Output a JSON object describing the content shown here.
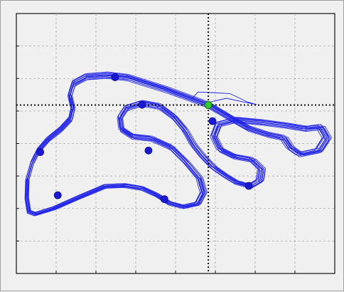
{
  "chart_data": {
    "type": "scatter",
    "title": "",
    "xlabel": "",
    "ylabel": "",
    "grid": true,
    "xlim": [
      0,
      100
    ],
    "ylim": [
      0,
      100
    ],
    "x_ticks": [
      0,
      12.5,
      25,
      37.5,
      50,
      62.5,
      75,
      87.5,
      100
    ],
    "y_ticks": [
      0,
      12.5,
      25,
      37.5,
      50,
      62.5,
      75,
      87.5,
      100
    ],
    "crosshair": {
      "x": 60.3,
      "y": 64.8
    },
    "colors": {
      "trace": "#1f22e6",
      "marker": "#1a1ad6",
      "current": "#2ecc2e",
      "grid": "#a8a8a8",
      "crosshair": "#111111",
      "background": "#f0f0f0"
    },
    "markers": [
      {
        "x": 31.0,
        "y": 75.5
      },
      {
        "x": 39.5,
        "y": 64.9
      },
      {
        "x": 41.5,
        "y": 47.3
      },
      {
        "x": 46.5,
        "y": 28.6
      },
      {
        "x": 61.6,
        "y": 58.6
      },
      {
        "x": 73.0,
        "y": 33.7
      },
      {
        "x": 7.5,
        "y": 46.7
      },
      {
        "x": 13.0,
        "y": 30.1
      }
    ],
    "current_point": {
      "x": 60.3,
      "y": 64.8
    },
    "track": [
      [
        60.3,
        64.8
      ],
      [
        47.5,
        70.5
      ],
      [
        35.0,
        75.3
      ],
      [
        28.5,
        76.2
      ],
      [
        22.0,
        75.6
      ],
      [
        18.0,
        73.0
      ],
      [
        16.8,
        68.2
      ],
      [
        17.8,
        63.5
      ],
      [
        17.0,
        59.3
      ],
      [
        14.0,
        55.4
      ],
      [
        10.0,
        51.5
      ],
      [
        7.0,
        47.3
      ],
      [
        5.0,
        42.5
      ],
      [
        3.5,
        36.1
      ],
      [
        3.3,
        29.1
      ],
      [
        4.0,
        23.7
      ],
      [
        6.0,
        22.8
      ],
      [
        12.0,
        25.1
      ],
      [
        20.0,
        29.4
      ],
      [
        28.0,
        33.5
      ],
      [
        34.0,
        33.8
      ],
      [
        39.5,
        32.7
      ],
      [
        44.0,
        30.2
      ],
      [
        48.0,
        27.0
      ],
      [
        52.5,
        25.6
      ],
      [
        57.0,
        26.8
      ],
      [
        58.8,
        31.0
      ],
      [
        57.5,
        36.6
      ],
      [
        53.5,
        42.5
      ],
      [
        48.5,
        48.5
      ],
      [
        42.5,
        51.8
      ],
      [
        36.5,
        52.6
      ],
      [
        33.0,
        55.4
      ],
      [
        32.5,
        59.8
      ],
      [
        34.5,
        63.5
      ],
      [
        39.5,
        65.4
      ],
      [
        45.0,
        64.2
      ],
      [
        49.5,
        60.1
      ],
      [
        53.0,
        55.0
      ],
      [
        55.5,
        49.6
      ],
      [
        58.5,
        45.0
      ],
      [
        62.0,
        40.6
      ],
      [
        65.5,
        37.6
      ],
      [
        69.0,
        35.0
      ],
      [
        73.5,
        33.5
      ],
      [
        76.5,
        35.7
      ],
      [
        77.0,
        40.1
      ],
      [
        74.0,
        43.7
      ],
      [
        68.5,
        44.9
      ],
      [
        64.0,
        47.6
      ],
      [
        62.0,
        52.5
      ],
      [
        63.5,
        57.3
      ],
      [
        69.0,
        59.0
      ],
      [
        77.0,
        58.1
      ],
      [
        85.0,
        56.8
      ],
      [
        91.0,
        55.6
      ],
      [
        95.5,
        56.3
      ],
      [
        97.5,
        52.0
      ],
      [
        95.0,
        47.2
      ],
      [
        89.0,
        45.7
      ],
      [
        86.0,
        48.3
      ],
      [
        84.0,
        52.1
      ],
      [
        79.5,
        53.2
      ],
      [
        73.0,
        55.7
      ],
      [
        66.5,
        60.3
      ],
      [
        60.3,
        64.8
      ]
    ],
    "loops": [
      {
        "dx": 0.0,
        "dy": 0.0,
        "sx": 1.0,
        "sy": 1.0
      },
      {
        "dx": 0.4,
        "dy": 0.5,
        "sx": 1.005,
        "sy": 1.008
      },
      {
        "dx": -0.4,
        "dy": -0.4,
        "sx": 0.996,
        "sy": 0.994
      },
      {
        "dx": 0.8,
        "dy": -0.2,
        "sx": 1.008,
        "sy": 0.998
      },
      {
        "dx": -0.7,
        "dy": 0.7,
        "sx": 0.993,
        "sy": 1.004
      },
      {
        "dx": 0.2,
        "dy": 1.0,
        "sx": 1.0,
        "sy": 1.012
      },
      {
        "dx": -0.2,
        "dy": -0.9,
        "sx": 1.002,
        "sy": 0.99
      },
      {
        "dx": 1.0,
        "dy": 0.3,
        "sx": 1.01,
        "sy": 1.0
      },
      {
        "dx": -1.0,
        "dy": 0.1,
        "sx": 0.99,
        "sy": 1.002
      },
      {
        "dx": 0.5,
        "dy": -0.7,
        "sx": 1.004,
        "sy": 0.992
      },
      {
        "dx": -0.5,
        "dy": 0.9,
        "sx": 0.997,
        "sy": 1.01
      },
      {
        "dx": 0.1,
        "dy": -0.1,
        "sx": 1.015,
        "sy": 1.015
      }
    ],
    "excursion": [
      [
        55.0,
        67.0
      ],
      [
        57.0,
        69.8
      ],
      [
        61.0,
        69.6
      ],
      [
        67.0,
        69.2
      ],
      [
        69.5,
        67.8
      ],
      [
        72.5,
        66.0
      ],
      [
        75.5,
        65.0
      ],
      [
        72.0,
        65.8
      ],
      [
        66.0,
        67.4
      ],
      [
        61.0,
        66.0
      ]
    ]
  }
}
